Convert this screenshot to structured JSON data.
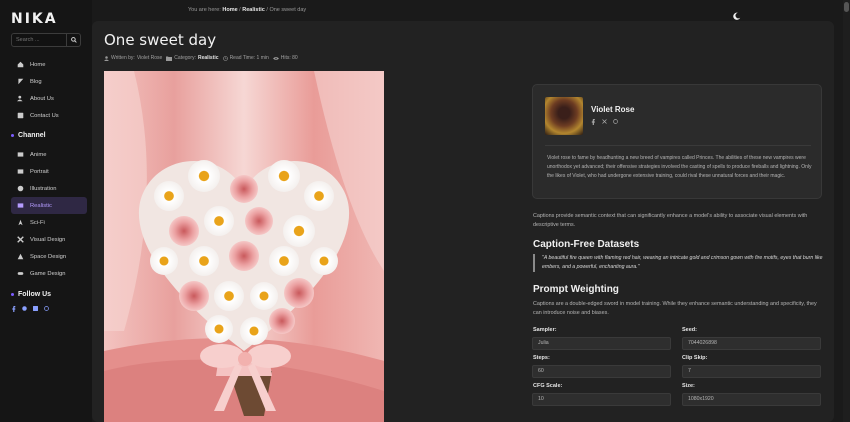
{
  "brand": {
    "logo": "NIKA"
  },
  "search": {
    "placeholder": "Search ..."
  },
  "nav": {
    "items": [
      {
        "label": "Home",
        "icon": "home-icon"
      },
      {
        "label": "Blog",
        "icon": "blog-icon"
      },
      {
        "label": "About Us",
        "icon": "users-icon"
      },
      {
        "label": "Contact Us",
        "icon": "contact-icon"
      }
    ]
  },
  "channel": {
    "title": "Channel",
    "items": [
      {
        "label": "Anime",
        "icon": "anime-icon"
      },
      {
        "label": "Portrait",
        "icon": "portrait-icon"
      },
      {
        "label": "Illustration",
        "icon": "illustration-icon"
      },
      {
        "label": "Realistic",
        "icon": "realistic-icon",
        "active": true
      },
      {
        "label": "Sci-Fi",
        "icon": "scifi-icon"
      },
      {
        "label": "Visual Design",
        "icon": "visual-design-icon"
      },
      {
        "label": "Space Design",
        "icon": "space-design-icon"
      },
      {
        "label": "Game Design",
        "icon": "game-design-icon"
      }
    ]
  },
  "follow": {
    "title": "Follow Us",
    "icons": [
      "facebook-icon",
      "github-icon",
      "linkedin-icon",
      "dribbble-icon"
    ]
  },
  "breadcrumb": {
    "prefix": "You are here:",
    "home": "Home",
    "sep": "/",
    "category": "Realistic",
    "current": "One sweet day"
  },
  "post": {
    "title": "One sweet day",
    "meta": {
      "written_by_label": "Written by:",
      "author": "Violet Rose",
      "category_label": "Category:",
      "category": "Realistic",
      "read_time": "Read Time: 1 min",
      "hits": "Hits: 80"
    }
  },
  "author_card": {
    "name": "Violet Rose",
    "bio": "Violet rose to fame by headhunting a new breed of vampires called Princes. The abilities of these new vampires were unorthodox yet advanced; their offensive strategies involved the casting of spells to produce fireballs and lightning. Only the likes of Violet, who had undergone extensive training, could rival these unnatural forces and their magic."
  },
  "content": {
    "intro": "Captions provide semantic context that can significantly enhance a model's ability to associate visual elements with descriptive terms.",
    "heading1": "Caption-Free Datasets",
    "quote": "\"A beautiful fire queen with flaming red hair, wearing an intricate gold and crimson gown with fire motifs, eyes that burn like embers, and a powerful, enchanting aura.\"",
    "heading2": "Prompt Weighting",
    "para2": "Captions are a double-edged sword in model training. While they enhance semantic understanding and specificity, they can introduce noise and biases."
  },
  "params": [
    {
      "label": "Sampler:",
      "value": "Julia"
    },
    {
      "label": "Seed:",
      "value": "7044026898"
    },
    {
      "label": "Steps:",
      "value": "60"
    },
    {
      "label": "Clip Skip:",
      "value": "7"
    },
    {
      "label": "CFG Scale:",
      "value": "10"
    },
    {
      "label": "Size:",
      "value": "1080x1920"
    }
  ],
  "colors": {
    "accent": "#7b5cff",
    "active_bg": "#2f2844",
    "panel": "#222222",
    "background": "#1a1a1a"
  }
}
